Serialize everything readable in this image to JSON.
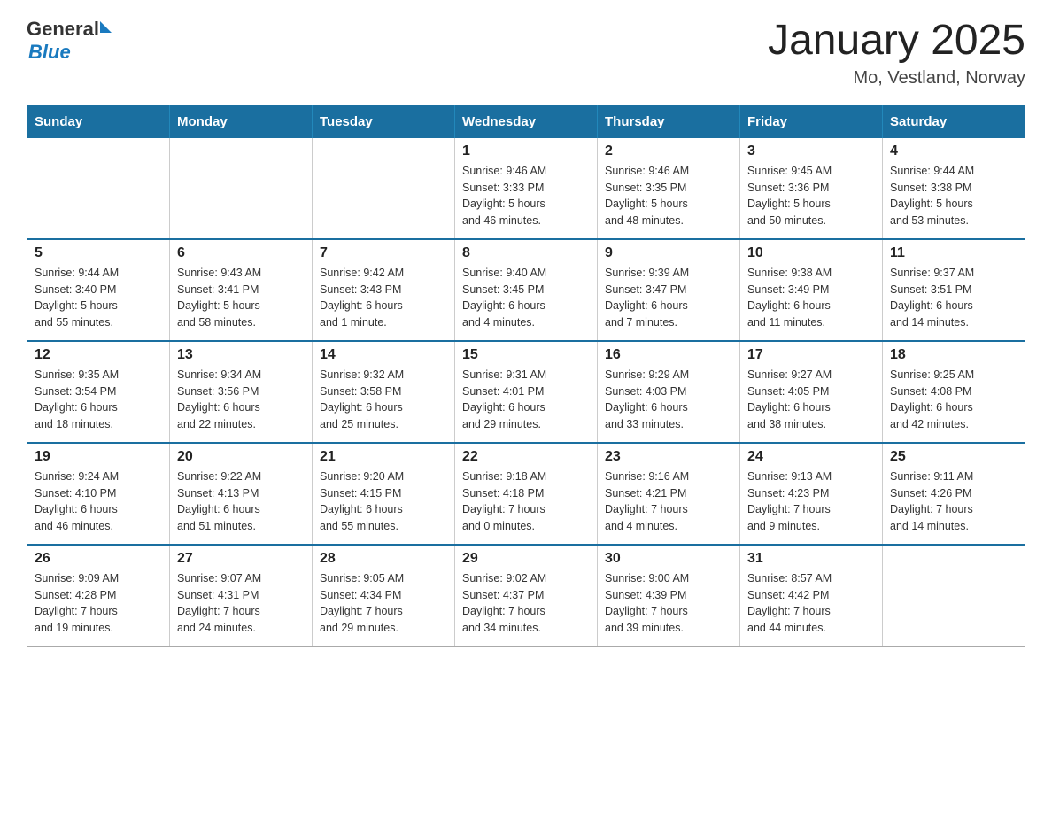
{
  "logo": {
    "text_general": "General",
    "text_blue": "Blue"
  },
  "title": "January 2025",
  "subtitle": "Mo, Vestland, Norway",
  "days_of_week": [
    "Sunday",
    "Monday",
    "Tuesday",
    "Wednesday",
    "Thursday",
    "Friday",
    "Saturday"
  ],
  "weeks": [
    [
      {
        "day": "",
        "info": ""
      },
      {
        "day": "",
        "info": ""
      },
      {
        "day": "",
        "info": ""
      },
      {
        "day": "1",
        "info": "Sunrise: 9:46 AM\nSunset: 3:33 PM\nDaylight: 5 hours\nand 46 minutes."
      },
      {
        "day": "2",
        "info": "Sunrise: 9:46 AM\nSunset: 3:35 PM\nDaylight: 5 hours\nand 48 minutes."
      },
      {
        "day": "3",
        "info": "Sunrise: 9:45 AM\nSunset: 3:36 PM\nDaylight: 5 hours\nand 50 minutes."
      },
      {
        "day": "4",
        "info": "Sunrise: 9:44 AM\nSunset: 3:38 PM\nDaylight: 5 hours\nand 53 minutes."
      }
    ],
    [
      {
        "day": "5",
        "info": "Sunrise: 9:44 AM\nSunset: 3:40 PM\nDaylight: 5 hours\nand 55 minutes."
      },
      {
        "day": "6",
        "info": "Sunrise: 9:43 AM\nSunset: 3:41 PM\nDaylight: 5 hours\nand 58 minutes."
      },
      {
        "day": "7",
        "info": "Sunrise: 9:42 AM\nSunset: 3:43 PM\nDaylight: 6 hours\nand 1 minute."
      },
      {
        "day": "8",
        "info": "Sunrise: 9:40 AM\nSunset: 3:45 PM\nDaylight: 6 hours\nand 4 minutes."
      },
      {
        "day": "9",
        "info": "Sunrise: 9:39 AM\nSunset: 3:47 PM\nDaylight: 6 hours\nand 7 minutes."
      },
      {
        "day": "10",
        "info": "Sunrise: 9:38 AM\nSunset: 3:49 PM\nDaylight: 6 hours\nand 11 minutes."
      },
      {
        "day": "11",
        "info": "Sunrise: 9:37 AM\nSunset: 3:51 PM\nDaylight: 6 hours\nand 14 minutes."
      }
    ],
    [
      {
        "day": "12",
        "info": "Sunrise: 9:35 AM\nSunset: 3:54 PM\nDaylight: 6 hours\nand 18 minutes."
      },
      {
        "day": "13",
        "info": "Sunrise: 9:34 AM\nSunset: 3:56 PM\nDaylight: 6 hours\nand 22 minutes."
      },
      {
        "day": "14",
        "info": "Sunrise: 9:32 AM\nSunset: 3:58 PM\nDaylight: 6 hours\nand 25 minutes."
      },
      {
        "day": "15",
        "info": "Sunrise: 9:31 AM\nSunset: 4:01 PM\nDaylight: 6 hours\nand 29 minutes."
      },
      {
        "day": "16",
        "info": "Sunrise: 9:29 AM\nSunset: 4:03 PM\nDaylight: 6 hours\nand 33 minutes."
      },
      {
        "day": "17",
        "info": "Sunrise: 9:27 AM\nSunset: 4:05 PM\nDaylight: 6 hours\nand 38 minutes."
      },
      {
        "day": "18",
        "info": "Sunrise: 9:25 AM\nSunset: 4:08 PM\nDaylight: 6 hours\nand 42 minutes."
      }
    ],
    [
      {
        "day": "19",
        "info": "Sunrise: 9:24 AM\nSunset: 4:10 PM\nDaylight: 6 hours\nand 46 minutes."
      },
      {
        "day": "20",
        "info": "Sunrise: 9:22 AM\nSunset: 4:13 PM\nDaylight: 6 hours\nand 51 minutes."
      },
      {
        "day": "21",
        "info": "Sunrise: 9:20 AM\nSunset: 4:15 PM\nDaylight: 6 hours\nand 55 minutes."
      },
      {
        "day": "22",
        "info": "Sunrise: 9:18 AM\nSunset: 4:18 PM\nDaylight: 7 hours\nand 0 minutes."
      },
      {
        "day": "23",
        "info": "Sunrise: 9:16 AM\nSunset: 4:21 PM\nDaylight: 7 hours\nand 4 minutes."
      },
      {
        "day": "24",
        "info": "Sunrise: 9:13 AM\nSunset: 4:23 PM\nDaylight: 7 hours\nand 9 minutes."
      },
      {
        "day": "25",
        "info": "Sunrise: 9:11 AM\nSunset: 4:26 PM\nDaylight: 7 hours\nand 14 minutes."
      }
    ],
    [
      {
        "day": "26",
        "info": "Sunrise: 9:09 AM\nSunset: 4:28 PM\nDaylight: 7 hours\nand 19 minutes."
      },
      {
        "day": "27",
        "info": "Sunrise: 9:07 AM\nSunset: 4:31 PM\nDaylight: 7 hours\nand 24 minutes."
      },
      {
        "day": "28",
        "info": "Sunrise: 9:05 AM\nSunset: 4:34 PM\nDaylight: 7 hours\nand 29 minutes."
      },
      {
        "day": "29",
        "info": "Sunrise: 9:02 AM\nSunset: 4:37 PM\nDaylight: 7 hours\nand 34 minutes."
      },
      {
        "day": "30",
        "info": "Sunrise: 9:00 AM\nSunset: 4:39 PM\nDaylight: 7 hours\nand 39 minutes."
      },
      {
        "day": "31",
        "info": "Sunrise: 8:57 AM\nSunset: 4:42 PM\nDaylight: 7 hours\nand 44 minutes."
      },
      {
        "day": "",
        "info": ""
      }
    ]
  ]
}
